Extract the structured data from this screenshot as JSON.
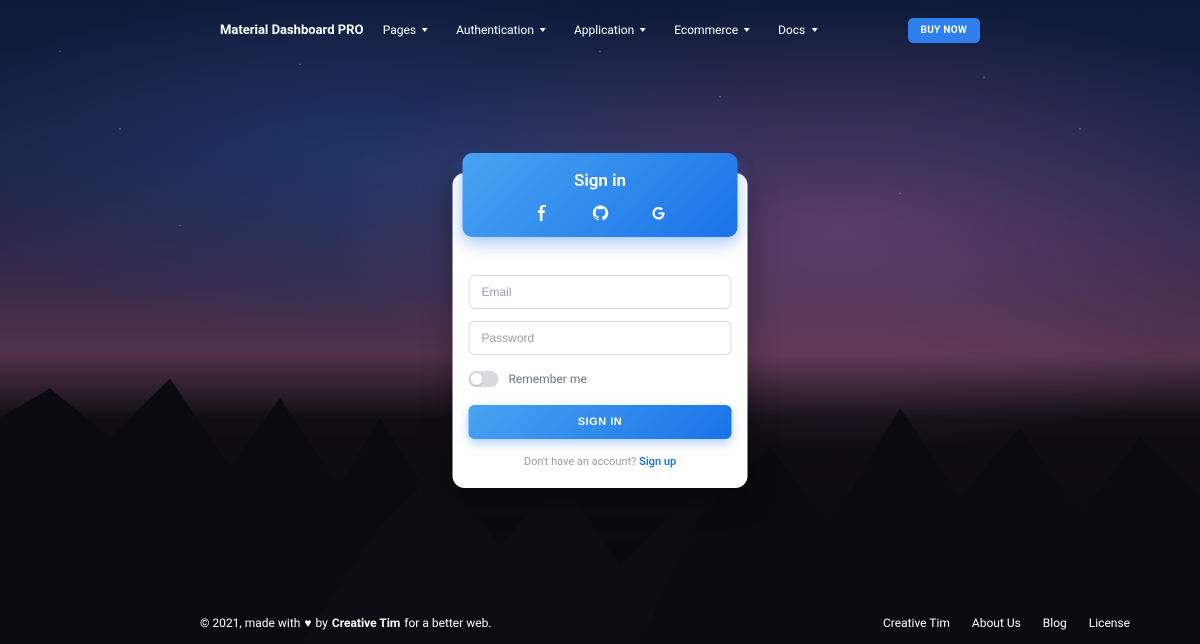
{
  "brand": "Material Dashboard PRO",
  "nav": {
    "items": [
      {
        "label": "Pages"
      },
      {
        "label": "Authentication"
      },
      {
        "label": "Application"
      },
      {
        "label": "Ecommerce"
      },
      {
        "label": "Docs"
      }
    ],
    "buy": "BUY NOW"
  },
  "card": {
    "title": "Sign in",
    "email_placeholder": "Email",
    "password_placeholder": "Password",
    "remember": "Remember me",
    "submit": "SIGN IN",
    "no_account": "Don't have an account? ",
    "signup": "Sign up"
  },
  "footer": {
    "copyright_prefix": "© 2021, made with",
    "by": "by",
    "author": "Creative Tim",
    "suffix": "for a better web.",
    "links": [
      {
        "label": "Creative Tim"
      },
      {
        "label": "About Us"
      },
      {
        "label": "Blog"
      },
      {
        "label": "License"
      }
    ]
  },
  "colors": {
    "primary": "#1a73e8",
    "primary_light": "#49a3f1"
  }
}
